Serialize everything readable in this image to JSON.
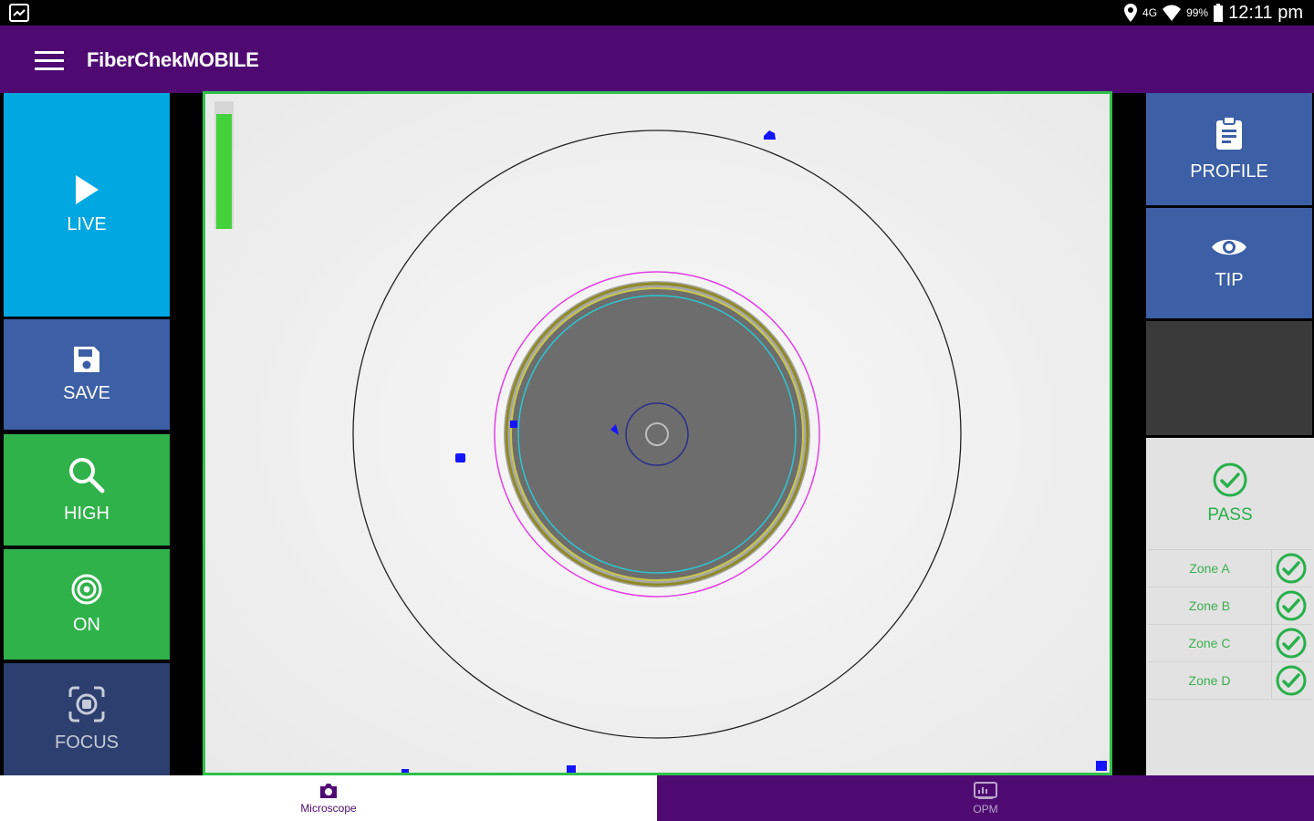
{
  "status": {
    "signal": "4G",
    "battery": "99%",
    "time": "12:11 pm"
  },
  "appbar": {
    "title": "FiberChekMOBILE"
  },
  "left_buttons": {
    "live": "LIVE",
    "save": "SAVE",
    "high": "HIGH",
    "on": "ON",
    "focus": "FOCUS"
  },
  "right_buttons": {
    "profile": "PROFILE",
    "tip": "TIP"
  },
  "result": {
    "label": "PASS",
    "zones": [
      "Zone A",
      "Zone B",
      "Zone C",
      "Zone D"
    ]
  },
  "viewer": {
    "focus_level": 0.9
  },
  "tabs": {
    "microscope": "Microscope",
    "opm": "OPM"
  },
  "colors": {
    "primary": "#4f0a72",
    "live": "#00a7e1",
    "save": "#3c5fa6",
    "green": "#2fb24a",
    "focus": "#2c3f6e",
    "pass": "#27b04a"
  }
}
